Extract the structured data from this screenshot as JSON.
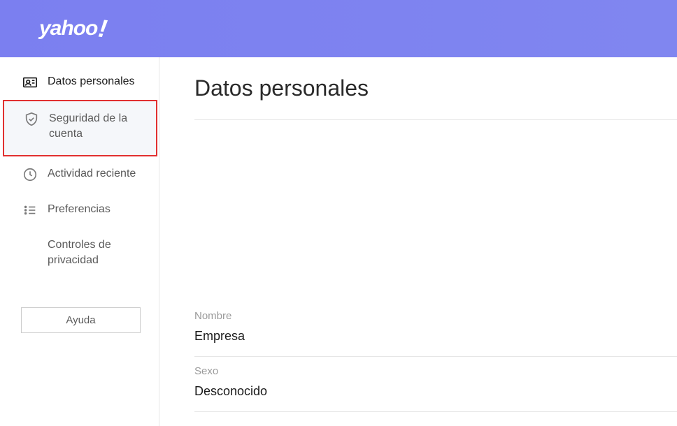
{
  "header": {
    "logo_text": "yahoo",
    "logo_exclaim": "!"
  },
  "sidebar": {
    "items": [
      {
        "label": "Datos personales"
      },
      {
        "label": "Seguridad de la cuenta"
      },
      {
        "label": "Actividad reciente"
      },
      {
        "label": "Preferencias"
      },
      {
        "label": "Controles de privacidad"
      }
    ],
    "help_label": "Ayuda"
  },
  "main": {
    "title": "Datos personales",
    "fields": [
      {
        "label": "Nombre",
        "value": "Empresa"
      },
      {
        "label": "Sexo",
        "value": "Desconocido"
      }
    ]
  }
}
